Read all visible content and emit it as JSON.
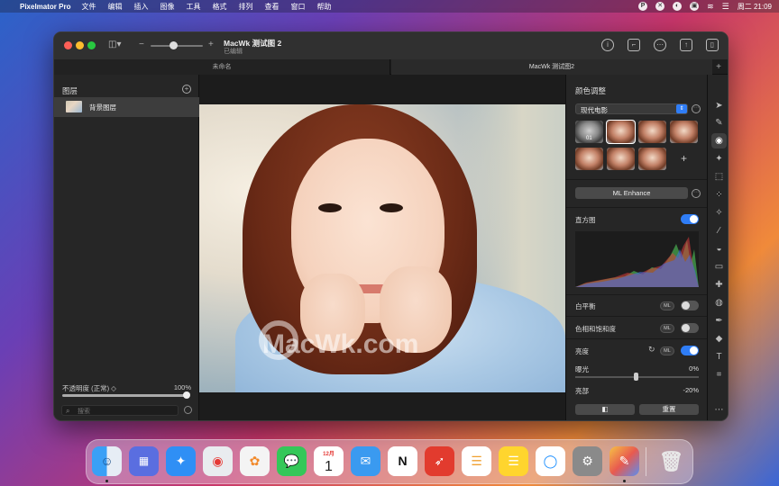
{
  "menubar": {
    "apple": "",
    "app_name": "Pixelmator Pro",
    "items": [
      "文件",
      "编辑",
      "插入",
      "图像",
      "工具",
      "格式",
      "排列",
      "查看",
      "窗口",
      "帮助"
    ],
    "clock": "周二 21:09"
  },
  "window": {
    "doc_title": "MacWk 测试图 2",
    "doc_subtitle": "已编辑",
    "tabs": [
      {
        "label": "未命名"
      },
      {
        "label": "MacWk 测试图2"
      }
    ],
    "zoom_minus": "−",
    "zoom_plus": "+"
  },
  "layers_panel": {
    "title": "图层",
    "layers": [
      {
        "name": "背景图层"
      }
    ],
    "opacity_label": "不透明度 (正常) ◇",
    "opacity_value": "100%",
    "opacity_fraction": 1.0,
    "search_placeholder": "搜索"
  },
  "canvas": {
    "watermark": "MacWk.com"
  },
  "adjust_panel": {
    "title": "颜色调整",
    "preset_select": "现代电影",
    "preset_first_label": "01",
    "preset_add": "+",
    "ml_enhance": "ML Enhance",
    "histogram_label": "直方图",
    "histogram_on": true,
    "white_balance": {
      "label": "白平衡",
      "ml": "ML",
      "on": false
    },
    "hue_sat": {
      "label": "色相和饱和度",
      "ml": "ML",
      "on": false
    },
    "brightness": {
      "label": "亮度",
      "ml": "ML",
      "on": true
    },
    "exposure": {
      "label": "曝光",
      "value": "0%",
      "fraction": 0.5
    },
    "highlights": {
      "label": "亮部",
      "value": "-20%"
    },
    "compare_button": "◧",
    "reset_button": "重置"
  },
  "dock": {
    "calendar_month": "12月",
    "calendar_day": "1",
    "apps": [
      {
        "icon": "finder-icon",
        "color": "#2a8cf0",
        "running": true
      },
      {
        "icon": "launchpad-icon",
        "color": "#5a6ee0",
        "running": false
      },
      {
        "icon": "safari-icon",
        "color": "#2f8ff5",
        "running": false
      },
      {
        "icon": "chrome-icon",
        "color": "#e9ecef",
        "running": false
      },
      {
        "icon": "photos-icon",
        "color": "#f4f4f4",
        "running": false
      },
      {
        "icon": "messages-icon",
        "color": "#34c759",
        "running": false
      },
      {
        "icon": "calendar-icon",
        "color": "#ffffff",
        "running": false
      },
      {
        "icon": "mail-icon",
        "color": "#3a9af0",
        "running": false
      },
      {
        "icon": "notion-icon",
        "color": "#ffffff",
        "running": false
      },
      {
        "icon": "rosetta-icon",
        "color": "#e23b2e",
        "running": false
      },
      {
        "icon": "reminders-icon",
        "color": "#ffffff",
        "running": false
      },
      {
        "icon": "notes-icon",
        "color": "#ffd52e",
        "running": false
      },
      {
        "icon": "circle-app-icon",
        "color": "#ffffff",
        "running": false
      },
      {
        "icon": "system-preferences-icon",
        "color": "#8a8a8a",
        "running": false
      },
      {
        "icon": "pixelmator-icon",
        "color": "#e85a4f",
        "running": true
      },
      {
        "icon": "trash-icon",
        "color": "#d8d8d8",
        "running": false
      }
    ]
  },
  "colors": {
    "accent": "#2f7df6",
    "window_bg": "#262626"
  }
}
